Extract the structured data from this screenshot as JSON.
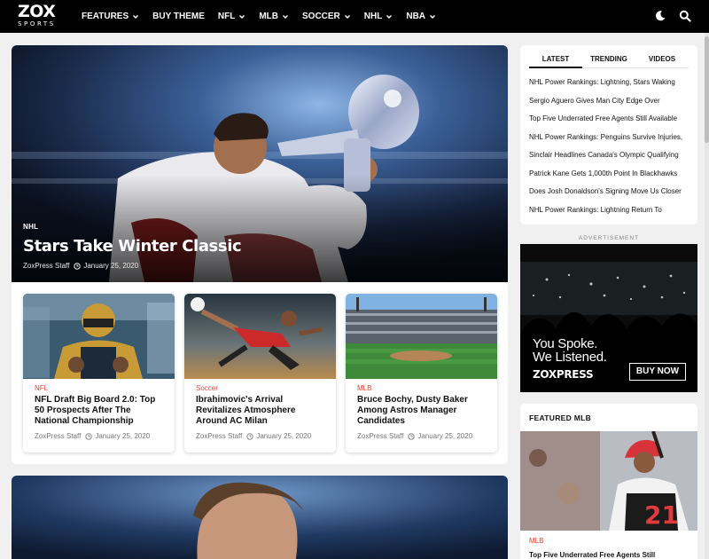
{
  "header": {
    "logo_main": "ZOX",
    "logo_sub": "SPORTS",
    "nav": [
      {
        "label": "FEATURES",
        "dropdown": true
      },
      {
        "label": "BUY THEME",
        "dropdown": false
      },
      {
        "label": "NFL",
        "dropdown": true
      },
      {
        "label": "MLB",
        "dropdown": true
      },
      {
        "label": "SOCCER",
        "dropdown": true
      },
      {
        "label": "NHL",
        "dropdown": true
      },
      {
        "label": "NBA",
        "dropdown": true
      }
    ],
    "icons": [
      "moon-icon",
      "search-icon"
    ]
  },
  "hero": {
    "category": "NHL",
    "title": "Stars Take Winter Classic",
    "author": "ZoxPress Staff",
    "date": "January 25, 2020"
  },
  "cards": [
    {
      "category": "NFL",
      "title": "NFL Draft Big Board 2.0: Top 50 Prospects After The National Championship",
      "author": "ZoxPress Staff",
      "date": "January 25, 2020",
      "image": "football-player"
    },
    {
      "category": "Soccer",
      "title": "Ibrahimovic's Arrival Revitalizes Atmosphere Around AC Milan",
      "author": "ZoxPress Staff",
      "date": "January 25, 2020",
      "image": "soccer-kick"
    },
    {
      "category": "MLB",
      "title": "Bruce Bochy, Dusty Baker Among Astros Manager Candidates",
      "author": "ZoxPress Staff",
      "date": "January 25, 2020",
      "image": "baseball-stadium"
    }
  ],
  "sidebar": {
    "tabs": [
      "LATEST",
      "TRENDING",
      "VIDEOS"
    ],
    "active_tab": "LATEST",
    "latest": [
      "NHL Power Rankings: Lightning, Stars Waking",
      "Sergio Aguero Gives Man City Edge Over",
      "Top Five Underrated Free Agents Still Available",
      "NHL Power Rankings: Penguins Survive Injuries,",
      "Sinclair Headlines Canada's Olympic Qualifying",
      "Patrick Kane Gets 1,000th Point In Blackhawks",
      "Does Josh Donaldson's Signing Move Us Closer",
      "NHL Power Rankings: Lightning Return To"
    ],
    "ad_label": "ADVERTISEMENT",
    "ad_line1": "You Spoke.",
    "ad_line2": "We Listened.",
    "ad_brand": "ZOXPRESS",
    "ad_button": "BUY NOW",
    "featured_heading": "FEATURED MLB",
    "featured_category": "MLB",
    "featured_title": "Top Five Underrated Free Agents Still"
  },
  "colors": {
    "accent": "#e8432c",
    "topbar": "#000000",
    "page_bg": "#f0f0f0"
  }
}
